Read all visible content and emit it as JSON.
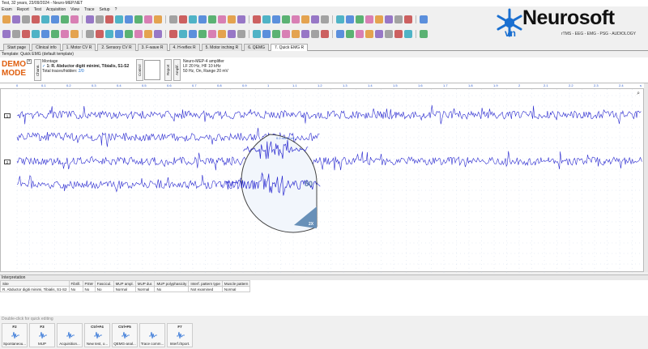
{
  "window": {
    "title": "Test, 32 years, 23/09/2024 - Neuro-MEP.NET"
  },
  "menu": [
    "Exam",
    "Report",
    "Test",
    "Acquisition",
    "View",
    "Trace",
    "Setup",
    "?"
  ],
  "logo": {
    "brand": "Neurosoft",
    "suffix": "vn",
    "subtitle": "rTMS - EEG - EMG - PSG - AUDIOLOGY"
  },
  "tabs": [
    {
      "label": "Start page"
    },
    {
      "label": "Clinical info"
    },
    {
      "label": "1. Motor CV R"
    },
    {
      "label": "2. Sensory CV R"
    },
    {
      "label": "3. F-wave R"
    },
    {
      "label": "4. H-reflex R"
    },
    {
      "label": "5. Motor inching R"
    },
    {
      "label": "6. QEMG"
    },
    {
      "label": "7. Quick EMG R"
    }
  ],
  "template": "Template: Quick EMG (default template)",
  "demo": {
    "line1": "DEMO",
    "line2": "MODE"
  },
  "montage": {
    "title": "Montage",
    "site": "1: R. Abductor digiti minimi, Tibialis, S1-S2",
    "traces_label": "Total traces/hidden:",
    "traces_value": "2/0"
  },
  "vtabs": {
    "chann": "Chann.",
    "control": "Control",
    "report": "Report",
    "amplif": "Amplif."
  },
  "amplifier": {
    "title": "Neuro-MEP-4 amplifier",
    "line1": "LF  20 Hz,  HF  10 kHz",
    "line2": "50 Hz,  On,  Range 20 mV"
  },
  "ruler_ticks": [
    "0",
    "0.1",
    "0.2",
    "0.3",
    "0.4",
    "0.5",
    "0.6",
    "0.7",
    "0.8",
    "0.9",
    "1",
    "1.1",
    "1.2",
    "1.3",
    "1.4",
    "1.5",
    "1.6",
    "1.7",
    "1.8",
    "1.9",
    "2",
    "2.1",
    "2.2",
    "2.3",
    "2.4",
    "2.5"
  ],
  "ruler_unit": "s",
  "channels": [
    {
      "label": "1"
    },
    {
      "label": "2"
    }
  ],
  "magnifier": {
    "scale_label": "0.2 ms 1 mV",
    "value_label": "50",
    "zoom_label": "2X"
  },
  "interpretation": {
    "header": "Interpretation",
    "columns": [
      "Site",
      "Fibrill.",
      "PSW",
      "Fascicul.",
      "MUP ampl.",
      "MUP dur.",
      "MUP polyphasicity",
      "Interf. pattern type",
      "Muscle pattern"
    ],
    "rows": [
      [
        "R. Abductor digiti minimi, Tibialis, S1-S2",
        "No",
        "No",
        "No",
        "Normal",
        "Normal",
        "No",
        "Not examined",
        "Normal"
      ]
    ]
  },
  "hint": "Double-click for quick editing",
  "fkeys": [
    {
      "key": "F2",
      "label": "Spontaneou..."
    },
    {
      "key": "F3",
      "label": "MUP"
    },
    {
      "key": "",
      "label": "Acquisition..."
    },
    {
      "key": "Ctrl+F4",
      "label": "New test, o..."
    },
    {
      "key": "Ctrl+F5",
      "label": "QEMG-anal..."
    },
    {
      "key": "",
      "label": "Trace comm..."
    },
    {
      "key": "F7",
      "label": "Interf./Sport."
    }
  ]
}
